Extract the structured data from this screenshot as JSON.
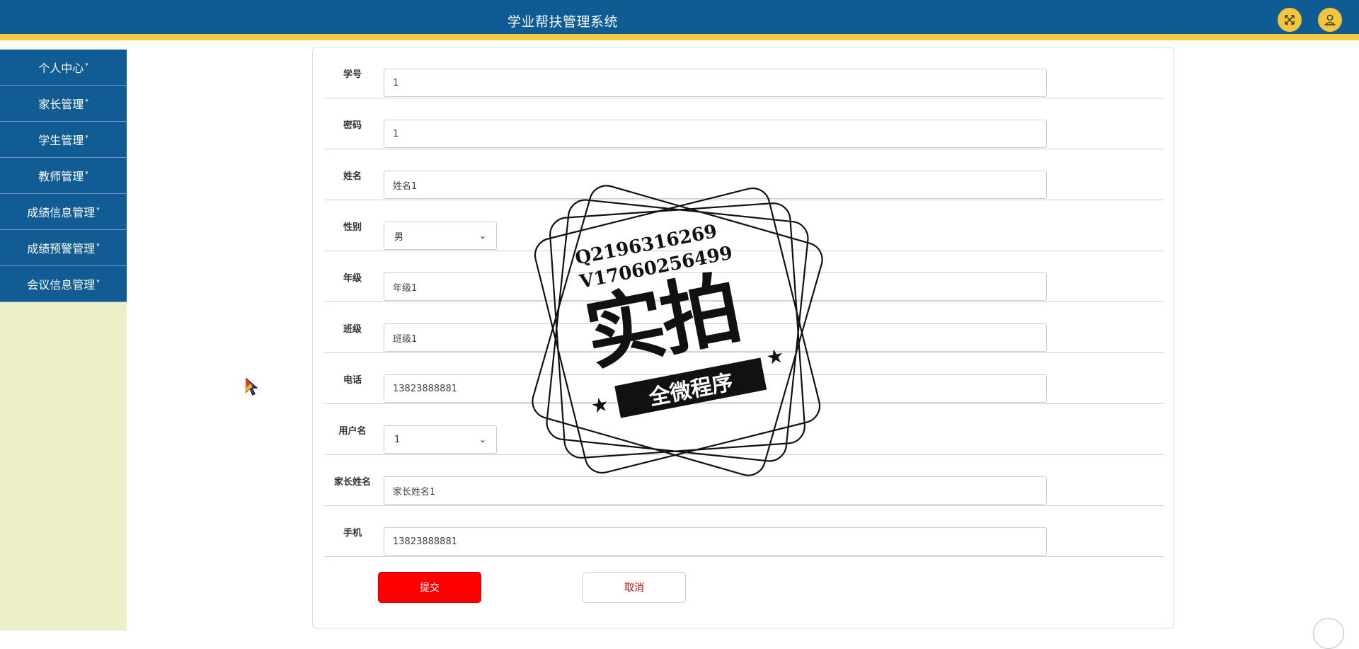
{
  "header": {
    "title": "学业帮扶管理系统",
    "icons": [
      "fullscreen-icon",
      "user-icon"
    ]
  },
  "sidebar": {
    "items": [
      {
        "label": "个人中心"
      },
      {
        "label": "家长管理"
      },
      {
        "label": "学生管理"
      },
      {
        "label": "教师管理"
      },
      {
        "label": "成绩信息管理"
      },
      {
        "label": "成绩预警管理"
      },
      {
        "label": "会议信息管理"
      }
    ]
  },
  "form": {
    "fields": [
      {
        "label": "学号",
        "value": "1"
      },
      {
        "label": "密码",
        "value": "1"
      },
      {
        "label": "姓名",
        "value": "姓名1"
      },
      {
        "label": "性别",
        "value": "男"
      },
      {
        "label": "年级",
        "value": "年级1"
      },
      {
        "label": "班级",
        "value": "班级1"
      },
      {
        "label": "电话",
        "value": "13823888881"
      },
      {
        "label": "用户名",
        "value": "1"
      },
      {
        "label": "家长姓名",
        "value": "家长姓名1"
      },
      {
        "label": "手机",
        "value": "13823888881"
      }
    ],
    "submit_label": "提交",
    "cancel_label": "取消"
  },
  "watermark": {
    "qq": "Q2196316269",
    "vx": "V17060256499",
    "big_text": "实拍",
    "banner_text": "全微程序"
  },
  "colors": {
    "header_bg": "#0f5c94",
    "header_accent": "#f3cb3e",
    "sidebar_item_bg": "#105c93",
    "sidebar_bg": "#ecefc7",
    "submit_bg": "#ff0000"
  }
}
